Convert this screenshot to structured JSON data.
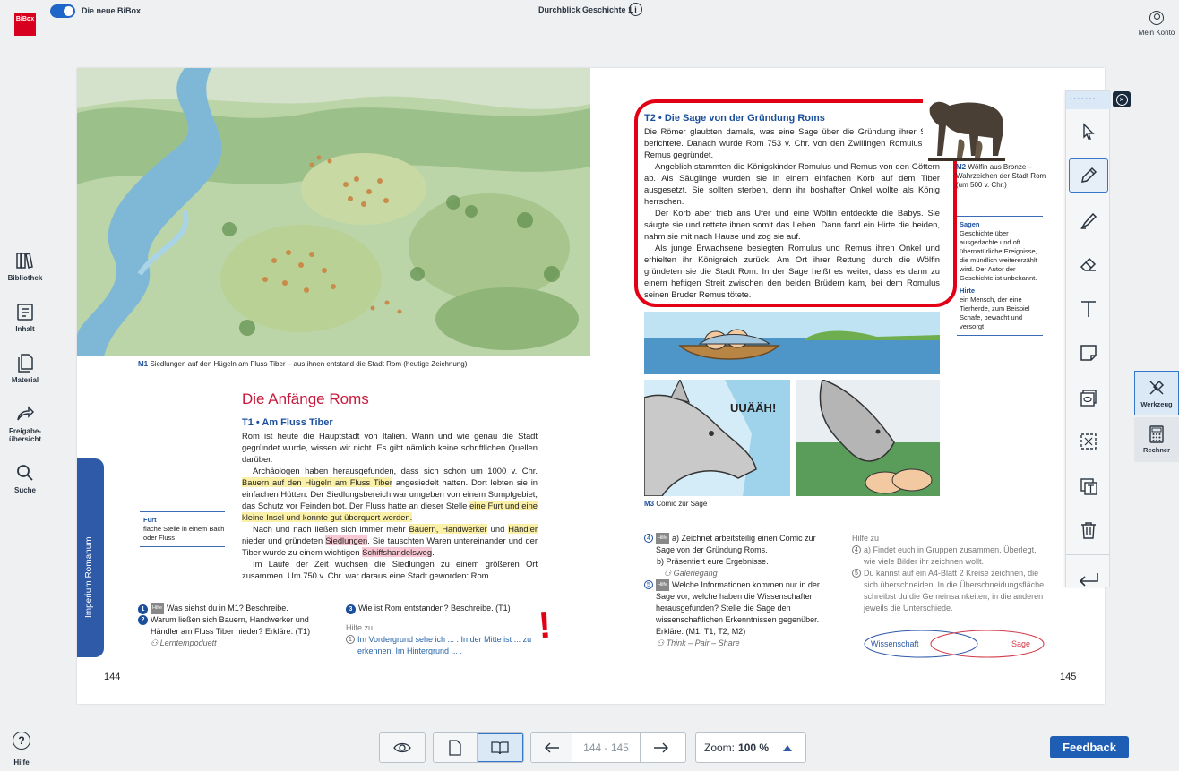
{
  "app": {
    "logo_text": "BiBox",
    "toggle_label": "Die neue BiBox",
    "book_title": "Durchblick Geschichte 1",
    "account_label": "Mein Konto"
  },
  "nav": [
    {
      "label": "Bibliothek",
      "icon": "library-icon"
    },
    {
      "label": "Inhalt",
      "icon": "contents-icon"
    },
    {
      "label": "Material",
      "icon": "material-icon"
    },
    {
      "label": "Freigabe-übersicht",
      "icon": "share-icon"
    },
    {
      "label": "Suche",
      "icon": "search-icon"
    }
  ],
  "help_label": "Hilfe",
  "left_page": {
    "m1_caption_ref": "M1",
    "m1_caption": "Siedlungen auf den Hügeln am Fluss Tiber – aus ihnen entstand die Stadt Rom (heutige Zeichnung)",
    "chapter_tab": "Imperium Romanum",
    "title": "Die Anfänge Roms",
    "t1_ref": "T1",
    "t1_title": "Am Fluss Tiber",
    "p1": "Rom ist heute die Hauptstadt von Italien. Wann und wie genau die Stadt gegründet wurde, wissen wir nicht. Es gibt nämlich keine schriftlichen Quellen darüber.",
    "p2a": "Archäologen haben herausgefunden, dass sich schon um 1000 v. Chr.",
    "p2_hl1": "Bauern auf den Hügeln am Fluss Tiber",
    "p2b": "angesiedelt hatten. Dort lebten sie in einfachen Hütten. Der Siedlungsbereich war umgeben von einem Sumpfgebiet, das Schutz vor Feinden bot. Der Fluss hatte an dieser Stelle",
    "p2_hl2": "eine Furt und eine kleine Insel und konnte gut überquert werden.",
    "p3a": "Nach und nach ließen sich immer mehr",
    "p3_hl1": "Bauern, Handwerker",
    "p3b": "und",
    "p3_hl2": "Händler",
    "p3c": "nieder und gründeten",
    "p3_hl3": "Siedlungen",
    "p3d": ". Sie tauschten Waren untereinander und der Tiber wurde zu einem wichtigen",
    "p3_hl4": "Schiffshandelsweg",
    "p3e": ".",
    "p4": "Im Laufe der Zeit wuchsen die Siedlungen zu einem größeren Ort zusammen. Um 750 v. Chr. war daraus eine Stadt geworden: Rom.",
    "gloss_term": "Furt",
    "gloss_def": "flache Stelle in einem Bach oder Fluss",
    "task1_num": "1",
    "task1_badge": "Hilfe",
    "task1": "Was siehst du in M1? Beschreibe.",
    "task2_num": "2",
    "task2": "Warum ließen sich Bauern, Handwerker und Händler am Fluss Tiber nieder? Erkläre. (T1)",
    "task2_method": "Lerntempoduett",
    "task3_num": "3",
    "task3": "Wie ist Rom entstanden? Beschreibe. (T1)",
    "hint_title": "Hilfe zu",
    "hint_num": "1",
    "hint_text": "Im Vordergrund sehe ich ... .  In der Mitte ist ... zu erkennen.  Im Hintergrund ... .",
    "page_number": "144",
    "annotation_mark": "!"
  },
  "right_page": {
    "t2_ref": "T2",
    "t2_title": "Die Sage von der Gründung Roms",
    "p1": "Die Römer glaubten damals, was eine Sage über die Gründung ihrer Stadt berichtete. Danach wurde Rom 753 v. Chr. von den Zwillingen Romulus und Remus gegründet.",
    "p2": "Angeblich stammten die Königskinder Romulus und Remus von den Göttern ab. Als Säuglinge wurden sie in einem einfachen Korb auf dem Tiber ausgesetzt. Sie sollten sterben, denn ihr boshafter Onkel wollte als König herrschen.",
    "p3": "Der Korb aber trieb ans Ufer und eine Wölfin entdeckte die Babys. Sie säugte sie und rettete ihnen somit das Leben. Dann fand ein Hirte die beiden, nahm sie mit nach Hause und zog sie auf.",
    "p4": "Als junge Erwachsene besiegten Romulus und Remus ihren Onkel und erhielten ihr Königreich zurück. Am Ort ihrer Rettung durch die Wölfin gründeten sie die Stadt Rom. In der Sage heißt es weiter, dass es dann zu einem heftigen Streit zwischen den beiden Brüdern kam, bei dem Romulus seinen Bruder Remus tötete.",
    "m2_ref": "M2",
    "m2_caption": "Wölfin aus Bronze – Wahrzeichen der Stadt Rom (um 500 v. Chr.)",
    "gloss1_term": "Sagen",
    "gloss1_def": "Geschichte über ausgedachte und oft übernatürliche Ereignisse, die mündlich weitererzählt wird. Der Autor der Geschichte ist unbekannt.",
    "gloss2_term": "Hirte",
    "gloss2_def": "ein Mensch, der eine Tierherde, zum Beispiel Schafe, bewacht und versorgt",
    "comic_sound": "UUÄÄH!",
    "m3_ref": "M3",
    "m3_caption": "Comic zur Sage",
    "task4_num": "4",
    "task4_badge": "Hilfe",
    "task4a": "a) Zeichnet arbeitsteilig einen Comic zur Sage von der Gründung Roms.",
    "task4b": "b) Präsentiert eure Ergebnisse.",
    "task4_method": "Galeriegang",
    "task5_num": "5",
    "task5_badge": "Hilfe",
    "task5": "Welche Informationen kommen nur in der Sage vor, welche haben die Wissenschafter herausgefunden? Stelle die Sage den wissenschaftlichen Erkenntnissen gegenüber. Erkläre. (M1, T1, T2, M2)",
    "task5_method": "Think – Pair – Share",
    "hint_title": "Hilfe zu",
    "hint4_num": "4",
    "hint4": "a) Findet euch in Gruppen zusammen. Überlegt, wie viele Bilder ihr zeichnen wollt.",
    "hint5_num": "5",
    "hint5": "Du kannst auf ein A4-Blatt 2 Kreise zeichnen, die sich überschneiden. In die Überschneidungsfläche schreibst du die Gemeinsamkeiten, in die anderen jeweils die Unterschiede.",
    "venn_left": "Wissenschaft",
    "venn_right": "Sage",
    "page_number": "145"
  },
  "toolbar": {
    "tools": [
      "pointer-icon",
      "pencil-icon",
      "marker-icon",
      "eraser-icon",
      "text-icon",
      "sticky-note-icon",
      "cover-icon",
      "crop-icon",
      "copy-text-icon",
      "trash-icon",
      "undo-icon"
    ]
  },
  "sidepanel": {
    "tool_label": "Werkzeug",
    "calc_label": "Rechner"
  },
  "bottom": {
    "pages": "144 - 145",
    "zoom_label": "Zoom:",
    "zoom_value": "100 %"
  },
  "feedback_label": "Feedback"
}
